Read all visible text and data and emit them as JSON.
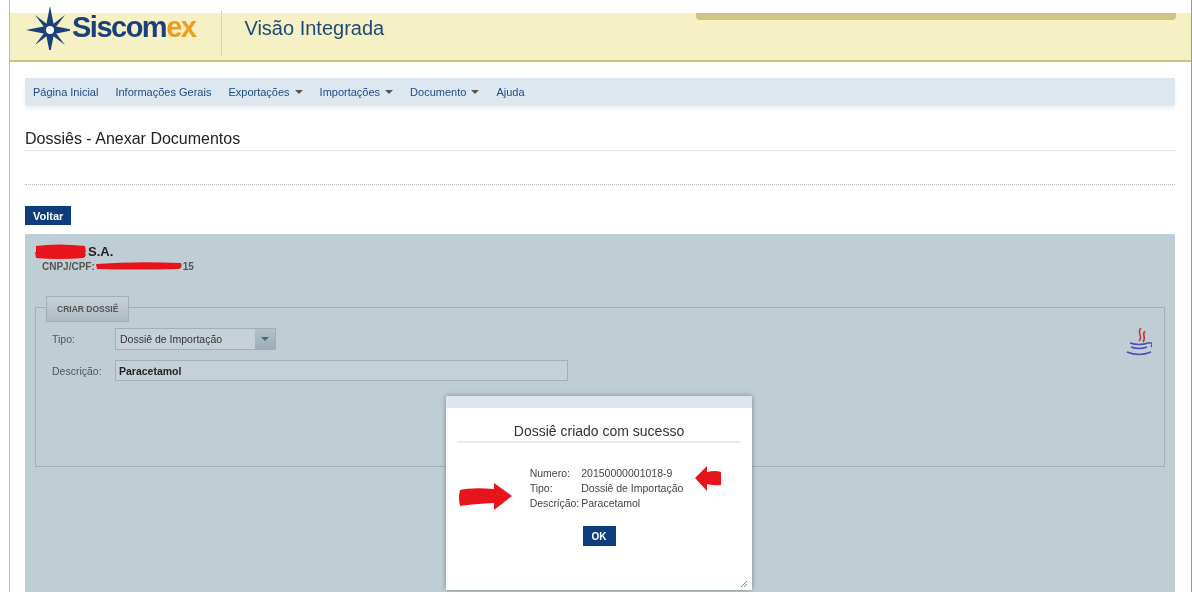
{
  "header": {
    "logo": {
      "main": "Siscom",
      "accent": "ex"
    },
    "title": "Visão Integrada"
  },
  "nav": [
    {
      "label": "Página Inicial",
      "dropdown": false
    },
    {
      "label": "Informações Gerais",
      "dropdown": false
    },
    {
      "label": "Exportações",
      "dropdown": true
    },
    {
      "label": "Importações",
      "dropdown": true
    },
    {
      "label": "Documento",
      "dropdown": true
    },
    {
      "label": "Ajuda",
      "dropdown": false
    }
  ],
  "page_title": "Dossiês - Anexar Documentos",
  "back_button": "Voltar",
  "company": {
    "name": "S.A.",
    "id_label": "CNPJ/CPF:",
    "id_value": "15"
  },
  "form": {
    "legend": "CRIAR DOSSIÊ",
    "fields": [
      {
        "kind": "select",
        "label": "Tipo:",
        "value": "Dossiê de Importação"
      },
      {
        "kind": "text",
        "label": "Descrição:",
        "value": "Paracetamol"
      }
    ]
  },
  "dialog": {
    "title": "Dossiê criado com sucesso",
    "rows": [
      {
        "label": "Numero:",
        "value": "20150000001018-9"
      },
      {
        "label": "Tipo:",
        "value": "Dossiê de Importação"
      },
      {
        "label": "Descrição:",
        "value": "Paracetamol"
      }
    ],
    "button": "OK"
  }
}
